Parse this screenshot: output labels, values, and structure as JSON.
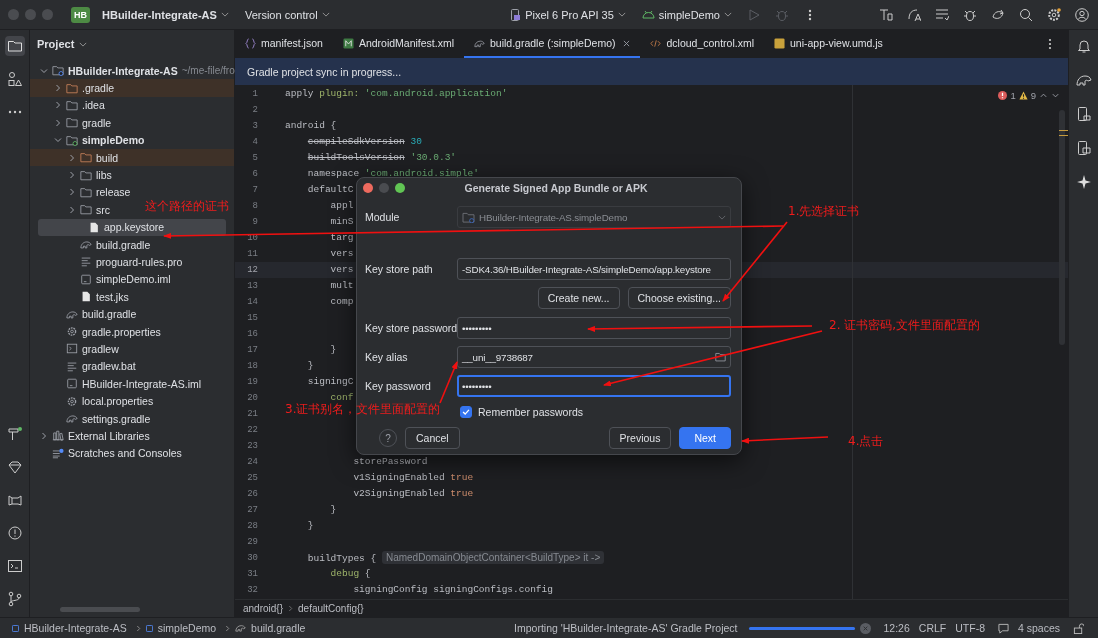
{
  "title_bar": {
    "project_badge": "HB",
    "project_name": "HBuilder-Integrate-AS",
    "vcs": "Version control",
    "device": "Pixel 6 Pro API 35",
    "run_config": "simpleDemo"
  },
  "project_panel": {
    "title": "Project",
    "tree": [
      {
        "name": "HBuilder-Integrate-AS",
        "hint": "~/me-file/fro",
        "kind": "module",
        "selected": false,
        "expanded": true,
        "children": [
          {
            "name": ".gradle",
            "kind": "excluded-folder",
            "selected": false,
            "expanded": false
          },
          {
            "name": ".idea",
            "kind": "folder",
            "selected": false,
            "expanded": false
          },
          {
            "name": "gradle",
            "kind": "folder",
            "selected": false,
            "expanded": false
          },
          {
            "name": "simpleDemo",
            "kind": "module",
            "selected": false,
            "expanded": true,
            "children": [
              {
                "name": "build",
                "kind": "excluded-folder",
                "selected": false,
                "expanded": false
              },
              {
                "name": "libs",
                "kind": "folder",
                "selected": false,
                "expanded": false
              },
              {
                "name": "release",
                "kind": "folder",
                "selected": false,
                "expanded": false
              },
              {
                "name": "src",
                "kind": "folder",
                "selected": false,
                "expanded": false
              },
              {
                "name": "app.keystore",
                "kind": "file",
                "selected": true
              },
              {
                "name": "build.gradle",
                "kind": "gradle",
                "selected": false
              },
              {
                "name": "proguard-rules.pro",
                "kind": "text",
                "selected": false
              },
              {
                "name": "simpleDemo.iml",
                "kind": "iml",
                "selected": false
              },
              {
                "name": "test.jks",
                "kind": "file",
                "selected": false
              }
            ]
          },
          {
            "name": "build.gradle",
            "kind": "gradle",
            "selected": false
          },
          {
            "name": "gradle.properties",
            "kind": "settings",
            "selected": false
          },
          {
            "name": "gradlew",
            "kind": "terminal",
            "selected": false
          },
          {
            "name": "gradlew.bat",
            "kind": "text",
            "selected": false
          },
          {
            "name": "HBuilder-Integrate-AS.iml",
            "kind": "iml",
            "selected": false
          },
          {
            "name": "local.properties",
            "kind": "settings",
            "selected": false
          },
          {
            "name": "settings.gradle",
            "kind": "gradle",
            "selected": false
          }
        ]
      },
      {
        "name": "External Libraries",
        "kind": "library",
        "selected": false,
        "expanded": false
      },
      {
        "name": "Scratches and Consoles",
        "kind": "scratches",
        "selected": false
      }
    ]
  },
  "editor": {
    "tabs": [
      {
        "label": "manifest.json",
        "kind": "json",
        "selected": false
      },
      {
        "label": "AndroidManifest.xml",
        "kind": "manifest",
        "selected": false
      },
      {
        "label": "build.gradle (:simpleDemo)",
        "kind": "gradle",
        "selected": true
      },
      {
        "label": "dcloud_control.xml",
        "kind": "xml",
        "selected": false
      },
      {
        "label": "uni-app-view.umd.js",
        "kind": "js",
        "selected": false
      }
    ],
    "banner": "Gradle project sync in progress...",
    "errors": "1",
    "warnings": "9",
    "lines": [
      {
        "n": "1",
        "current": false,
        "tokens": [
          {
            "text": "apply",
            "kind": "plain"
          },
          {
            "text": " plugin:",
            "kind": "param"
          },
          {
            "text": " 'com.android.application'",
            "kind": "string"
          }
        ]
      },
      {
        "n": "2",
        "current": false
      },
      {
        "n": "3",
        "current": false,
        "tokens": [
          {
            "text": "android {",
            "kind": "plain"
          }
        ]
      },
      {
        "n": "4",
        "current": false,
        "tokens": [
          {
            "text": "    compileSdkVersion",
            "kind": "deprecated"
          },
          {
            "text": " 30",
            "kind": "number"
          }
        ]
      },
      {
        "n": "5",
        "current": false,
        "tokens": [
          {
            "text": "    buildToolsVersion",
            "kind": "deprecated"
          },
          {
            "text": " '30.0.3'",
            "kind": "string"
          }
        ]
      },
      {
        "n": "6",
        "current": false,
        "tokens": [
          {
            "text": "    namespace",
            "kind": "plain"
          },
          {
            "text": " 'com.android.simple'",
            "kind": "string"
          }
        ]
      },
      {
        "n": "7",
        "current": false,
        "tokens": [
          {
            "text": "    defaultC",
            "kind": "plain"
          }
        ]
      },
      {
        "n": "8",
        "current": false,
        "tokens": [
          {
            "text": "        appl",
            "kind": "plain"
          }
        ]
      },
      {
        "n": "9",
        "current": false,
        "tokens": [
          {
            "text": "        minS",
            "kind": "plain"
          }
        ]
      },
      {
        "n": "10",
        "current": false,
        "tokens": [
          {
            "text": "        targ",
            "kind": "plain"
          }
        ]
      },
      {
        "n": "11",
        "current": false,
        "tokens": [
          {
            "text": "        vers",
            "kind": "plain"
          }
        ]
      },
      {
        "n": "12",
        "current": true,
        "tokens": [
          {
            "text": "        vers",
            "kind": "plain"
          }
        ]
      },
      {
        "n": "13",
        "current": false,
        "tokens": [
          {
            "text": "        mult",
            "kind": "plain"
          }
        ]
      },
      {
        "n": "14",
        "current": false,
        "tokens": [
          {
            "text": "        comp",
            "kind": "plain"
          }
        ]
      },
      {
        "n": "15",
        "current": false
      },
      {
        "n": "16",
        "current": false
      },
      {
        "n": "17",
        "current": false,
        "tokens": [
          {
            "text": "        }",
            "kind": "plain"
          }
        ]
      },
      {
        "n": "18",
        "current": false,
        "tokens": [
          {
            "text": "    }",
            "kind": "plain"
          }
        ]
      },
      {
        "n": "19",
        "current": false,
        "tokens": [
          {
            "text": "    signingC",
            "kind": "plain"
          }
        ]
      },
      {
        "n": "20",
        "current": false,
        "tokens": [
          {
            "text": "        conf",
            "kind": "param"
          }
        ]
      },
      {
        "n": "21",
        "current": false
      },
      {
        "n": "22",
        "current": false
      },
      {
        "n": "23",
        "current": false
      },
      {
        "n": "24",
        "current": false,
        "tokens": [
          {
            "text": "            storePassword",
            "kind": "plain"
          }
        ]
      },
      {
        "n": "25",
        "current": false,
        "tokens": [
          {
            "text": "            v1SigningEnabled",
            "kind": "plain"
          },
          {
            "text": " true",
            "kind": "keyword"
          }
        ]
      },
      {
        "n": "26",
        "current": false,
        "tokens": [
          {
            "text": "            v2SigningEnabled",
            "kind": "plain"
          },
          {
            "text": " true",
            "kind": "keyword"
          }
        ]
      },
      {
        "n": "27",
        "current": false,
        "tokens": [
          {
            "text": "        }",
            "kind": "plain"
          }
        ]
      },
      {
        "n": "28",
        "current": false,
        "tokens": [
          {
            "text": "    }",
            "kind": "plain"
          }
        ]
      },
      {
        "n": "29",
        "current": false
      },
      {
        "n": "30",
        "current": false,
        "tokens": [
          {
            "text": "    buildTypes {",
            "kind": "plain"
          },
          {
            "text": " NamedDomainObjectContainer<BuildType> it ->",
            "kind": "hint"
          }
        ]
      },
      {
        "n": "31",
        "current": false,
        "tokens": [
          {
            "text": "        debug",
            "kind": "param"
          },
          {
            "text": " {",
            "kind": "plain"
          }
        ]
      },
      {
        "n": "32",
        "current": false,
        "tokens": [
          {
            "text": "            signingConfig signingConfigs.config",
            "kind": "plain"
          }
        ]
      }
    ],
    "breadcrumbs": [
      "android{}",
      "defaultConfig{}"
    ]
  },
  "dialog": {
    "title": "Generate Signed App Bundle or APK",
    "fields": [
      {
        "label": "Module",
        "value": "HBuilder-Integrate-AS.simpleDemo",
        "kind": "dropdown",
        "disabled": true,
        "focused": false
      },
      {
        "label": "Key store path",
        "value": "-SDK4.36/HBuilder-Integrate-AS/simpleDemo/app.keystore",
        "kind": "text",
        "disabled": false,
        "focused": false
      },
      {
        "label": "Key store password",
        "value": "•••••••••",
        "kind": "text",
        "disabled": false,
        "focused": false
      },
      {
        "label": "Key alias",
        "value": "__uni__9738687",
        "kind": "browse",
        "disabled": false,
        "focused": false
      },
      {
        "label": "Key password",
        "value": "•••••••••",
        "kind": "text",
        "disabled": false,
        "focused": true
      }
    ],
    "keystore_buttons": [
      "Create new...",
      "Choose existing..."
    ],
    "remember": {
      "label": "Remember passwords",
      "checked": true
    },
    "help": "?",
    "buttons": [
      {
        "label": "Cancel",
        "primary": false
      },
      {
        "label": "Previous",
        "primary": false
      },
      {
        "label": "Next",
        "primary": true
      }
    ]
  },
  "annotations": [
    "这个路径的证书",
    "1.先选择证书",
    "2. 证书密码,文件里面配置的",
    "3.证书别名，文件里面配置的",
    "4.点击"
  ],
  "status_bar": {
    "path": [
      "HBuilder-Integrate-AS",
      "simpleDemo",
      "build.gradle"
    ],
    "task": "Importing 'HBuilder-Integrate-AS' Gradle Project",
    "level": 1,
    "position": "12:26",
    "line_sep": "CRLF",
    "encoding": "UTF-8",
    "indent": "4 spaces"
  }
}
